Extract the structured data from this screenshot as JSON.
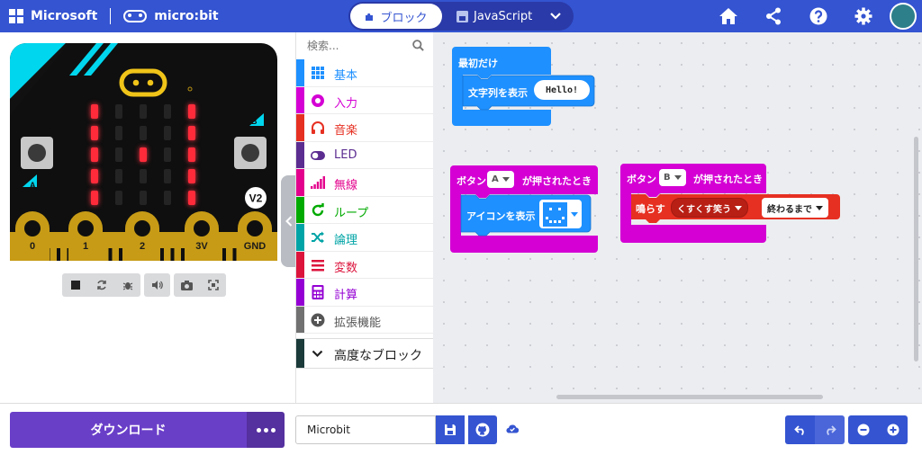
{
  "header": {
    "brand_microsoft": "Microsoft",
    "brand_microbit": "micro:bit",
    "mode_blocks": "ブロック",
    "mode_javascript": "JavaScript",
    "icons": [
      "home-icon",
      "share-icon",
      "help-icon",
      "settings-icon"
    ]
  },
  "simulator": {
    "pin_labels": [
      "0",
      "1",
      "2",
      "3V",
      "GND"
    ],
    "button_a": "A",
    "button_b": "B",
    "version": "V2",
    "led_on": [
      [
        1,
        0,
        0,
        0,
        1
      ],
      [
        1,
        0,
        0,
        0,
        1
      ],
      [
        1,
        0,
        1,
        0,
        1
      ],
      [
        1,
        0,
        0,
        0,
        1
      ],
      [
        1,
        0,
        0,
        0,
        1
      ]
    ]
  },
  "toolbox": {
    "search_placeholder": "検索...",
    "categories": [
      {
        "label": "基本",
        "color": "#1e90ff",
        "icon": "grid-icon"
      },
      {
        "label": "入力",
        "color": "#d400d4",
        "icon": "input-icon"
      },
      {
        "label": "音楽",
        "color": "#e63022",
        "icon": "headphones-icon"
      },
      {
        "label": "LED",
        "color": "#5c2d91",
        "icon": "toggle-icon"
      },
      {
        "label": "無線",
        "color": "#e3008c",
        "icon": "signal-icon"
      },
      {
        "label": "ループ",
        "color": "#00aa00",
        "icon": "loop-icon"
      },
      {
        "label": "論理",
        "color": "#00a4a6",
        "icon": "shuffle-icon"
      },
      {
        "label": "変数",
        "color": "#dc143c",
        "icon": "list-icon"
      },
      {
        "label": "計算",
        "color": "#9400d3",
        "icon": "calculator-icon"
      },
      {
        "label": "拡張機能",
        "color": "#717171",
        "icon": "plus-circle-icon"
      }
    ],
    "advanced_label": "高度なブロック",
    "advanced_color": "#1b3a3a"
  },
  "workspace": {
    "on_start": {
      "label": "最初だけ",
      "statement": "文字列を表示",
      "value": "Hello!"
    },
    "on_button_a": {
      "label_pre": "ボタン",
      "button": "A",
      "label_post": "が押されたとき",
      "statement": "アイコンを表示"
    },
    "on_button_b": {
      "label_pre": "ボタン",
      "button": "B",
      "label_post": "が押されたとき",
      "statement": "鳴らす",
      "melody": "くすくす笑う",
      "mode": "終わるまで"
    },
    "colors": {
      "basic": "#1e90ff",
      "input": "#d400d4",
      "music": "#e63022"
    }
  },
  "footer": {
    "download_label": "ダウンロード",
    "project_name": "Microbit"
  }
}
